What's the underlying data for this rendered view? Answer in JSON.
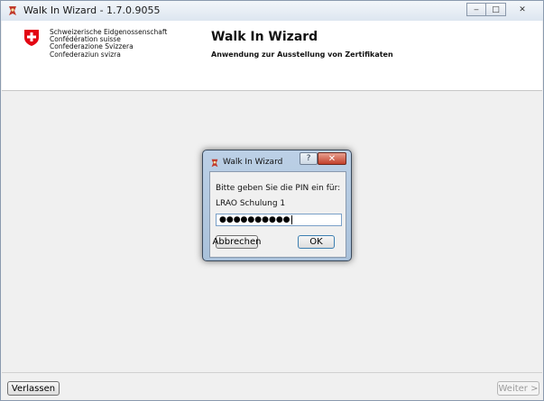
{
  "window": {
    "title": "Walk In Wizard - 1.7.0.9055",
    "buttons": {
      "minimize": "‒",
      "maximize": "□",
      "close": "✕"
    }
  },
  "header": {
    "federation_lines": [
      "Schweizerische Eidgenossenschaft",
      "Confédération suisse",
      "Confederazione Svizzera",
      "Confederaziun svizra"
    ],
    "app_title": "Walk In Wizard",
    "app_subtitle": "Anwendung zur Ausstellung von Zertifikaten"
  },
  "footer": {
    "leave_label": "Verlassen",
    "next_label": "Weiter >"
  },
  "dialog": {
    "title": "Walk In Wizard",
    "help_label": "?",
    "close_label": "✕",
    "prompt": "Bitte geben Sie die PIN ein für:",
    "target": "LRAO Schulung 1",
    "pin_value": "●●●●●●●●●●",
    "cancel_label": "Abbrechen",
    "ok_label": "OK"
  },
  "colors": {
    "swiss_red": "#e30613",
    "dialog_frame": "#b3c9e0"
  }
}
